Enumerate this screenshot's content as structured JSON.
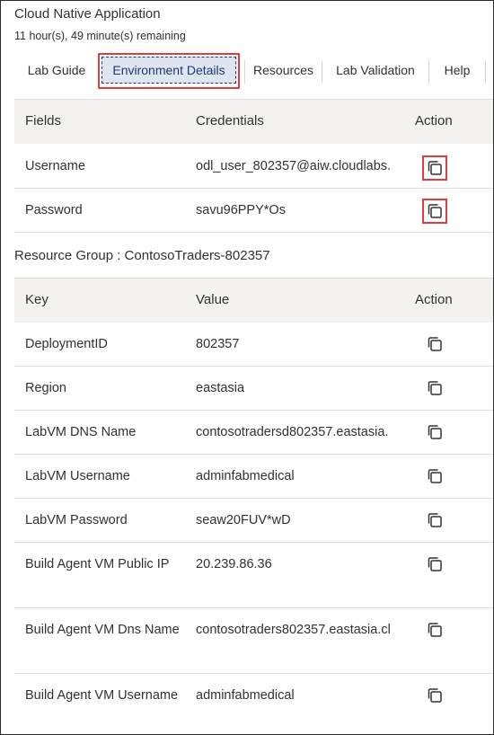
{
  "app": {
    "title": "Cloud Native Application",
    "timer": "11 hour(s), 49 minute(s) remaining"
  },
  "tabs": [
    {
      "label": "Lab Guide"
    },
    {
      "label": "Environment Details",
      "active": true
    },
    {
      "label": "Resources"
    },
    {
      "label": "Lab Validation"
    },
    {
      "label": "Help"
    }
  ],
  "credentials_table": {
    "headers": {
      "field": "Fields",
      "credential": "Credentials",
      "action": "Action"
    },
    "rows": [
      {
        "field": "Username",
        "value": "odl_user_802357@aiw.cloudlabs."
      },
      {
        "field": "Password",
        "value": "savu96PPY*Os"
      }
    ]
  },
  "resource_group": {
    "title": "Resource Group : ContosoTraders-802357",
    "headers": {
      "key": "Key",
      "value": "Value",
      "action": "Action"
    },
    "rows": [
      {
        "key": "DeploymentID",
        "value": "802357"
      },
      {
        "key": "Region",
        "value": "eastasia"
      },
      {
        "key": "LabVM DNS Name",
        "value": "contosotradersd802357.eastasia."
      },
      {
        "key": "LabVM Username",
        "value": "adminfabmedical"
      },
      {
        "key": "LabVM Password",
        "value": "seaw20FUV*wD"
      },
      {
        "key": "Build Agent VM Public IP",
        "value": "20.239.86.36"
      },
      {
        "key": "Build Agent VM Dns Name",
        "value": "contosotraders802357.eastasia.cl"
      },
      {
        "key": "Build Agent VM Username",
        "value": "adminfabmedical"
      }
    ]
  },
  "icons": {
    "copy": "copy-icon"
  },
  "colors": {
    "highlight": "#e03c3c",
    "active_tab_bg": "#dfe6f2",
    "active_tab_text": "#1b3a72",
    "header_bg": "#f3f2f1"
  }
}
